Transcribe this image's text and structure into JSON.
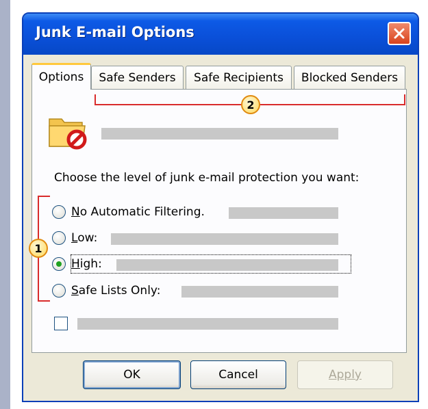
{
  "window": {
    "title": "Junk E-mail Options"
  },
  "tabs": [
    {
      "label": "Options",
      "active": true
    },
    {
      "label": "Safe Senders",
      "active": false
    },
    {
      "label": "Safe Recipients",
      "active": false
    },
    {
      "label": "Blocked Senders",
      "active": false
    }
  ],
  "options": {
    "icon": "junk-folder-icon",
    "prompt": "Choose the level of junk e-mail protection you want:",
    "levels": [
      {
        "accel": "N",
        "rest": "o Automatic Filtering.",
        "selected": false
      },
      {
        "accel": "L",
        "rest": "ow:",
        "selected": false
      },
      {
        "accel": "H",
        "rest": "igh:",
        "selected": true
      },
      {
        "accel": "S",
        "rest": "afe Lists Only:",
        "selected": false
      }
    ],
    "checkbox_checked": false
  },
  "buttons": {
    "ok": "OK",
    "cancel": "Cancel",
    "apply": "Apply"
  },
  "callouts": {
    "levels": "1",
    "tabs": "2"
  },
  "colors": {
    "accent": "#0a4fd8",
    "callout": "#d92b2b",
    "badge": "#ffd95a",
    "radio_selected": "#21a121"
  }
}
